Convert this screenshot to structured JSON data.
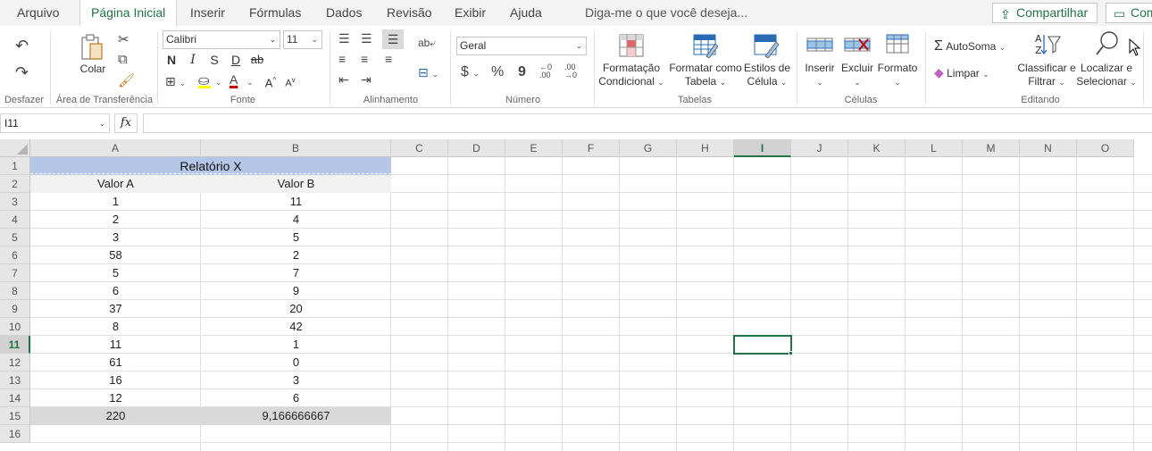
{
  "menu": {
    "tabs": [
      {
        "label": "Arquivo"
      },
      {
        "label": "Página Inicial"
      },
      {
        "label": "Inserir"
      },
      {
        "label": "Fórmulas"
      },
      {
        "label": "Dados"
      },
      {
        "label": "Revisão"
      },
      {
        "label": "Exibir"
      },
      {
        "label": "Ajuda"
      }
    ],
    "tell_me": "Diga-me o que você deseja...",
    "share": "Compartilhar",
    "comments": "Comentários"
  },
  "ribbon": {
    "undo_group": {
      "label": "Desfazer"
    },
    "clipboard": {
      "paste": "Colar",
      "label": "Área de Transferência"
    },
    "font": {
      "family": "Calibri",
      "size": "11",
      "bold": "N",
      "italic": "I",
      "strike_s": "S",
      "underline": "D",
      "strike": "ab",
      "grow": "A",
      "shrink": "A",
      "label": "Fonte"
    },
    "alignment": {
      "label": "Alinhamento"
    },
    "number": {
      "format": "Geral",
      "currency": "$",
      "percent": "%",
      "comma": "9",
      "label": "Número"
    },
    "tables": {
      "conditional": "Formatação Condicional",
      "conditional_l1": "Formatação",
      "conditional_l2": "Condicional",
      "as_table_l1": "Formatar como",
      "as_table_l2": "Tabela",
      "styles_l1": "Estilos de",
      "styles_l2": "Célula",
      "label": "Tabelas"
    },
    "cells": {
      "insert": "Inserir",
      "delete": "Excluir",
      "format": "Formato",
      "label": "Células"
    },
    "editing": {
      "autosum": "AutoSoma",
      "clear": "Limpar",
      "sort_l1": "Classificar e",
      "sort_l2": "Filtrar",
      "find_l1": "Localizar e",
      "find_l2": "Selecionar",
      "label": "Editando"
    }
  },
  "formula_bar": {
    "name_box": "I11",
    "fx": "fx",
    "formula": ""
  },
  "sheet": {
    "columns": [
      "A",
      "B",
      "C",
      "D",
      "E",
      "F",
      "G",
      "H",
      "I",
      "J",
      "K",
      "L",
      "M",
      "N",
      "O"
    ],
    "selected_column": "I",
    "selected_row": 11,
    "rows": [
      1,
      2,
      3,
      4,
      5,
      6,
      7,
      8,
      9,
      10,
      11,
      12,
      13,
      14,
      15,
      16
    ],
    "title": "Relatório X",
    "header_a": "Valor A",
    "header_b": "Valor B",
    "data": [
      {
        "a": "1",
        "b": "11"
      },
      {
        "a": "2",
        "b": "4"
      },
      {
        "a": "3",
        "b": "5"
      },
      {
        "a": "58",
        "b": "2"
      },
      {
        "a": "5",
        "b": "7"
      },
      {
        "a": "6",
        "b": "9"
      },
      {
        "a": "37",
        "b": "20"
      },
      {
        "a": "8",
        "b": "42"
      },
      {
        "a": "11",
        "b": "1"
      },
      {
        "a": "61",
        "b": "0"
      },
      {
        "a": "16",
        "b": "3"
      },
      {
        "a": "12",
        "b": "6"
      }
    ],
    "totals": {
      "a": "220",
      "b": "9,166666667"
    },
    "colors": {
      "title_fill": "#b4c7e7",
      "header_fill": "#f2f2f2",
      "total_fill": "#d9d9d9",
      "accent": "#217346"
    }
  }
}
